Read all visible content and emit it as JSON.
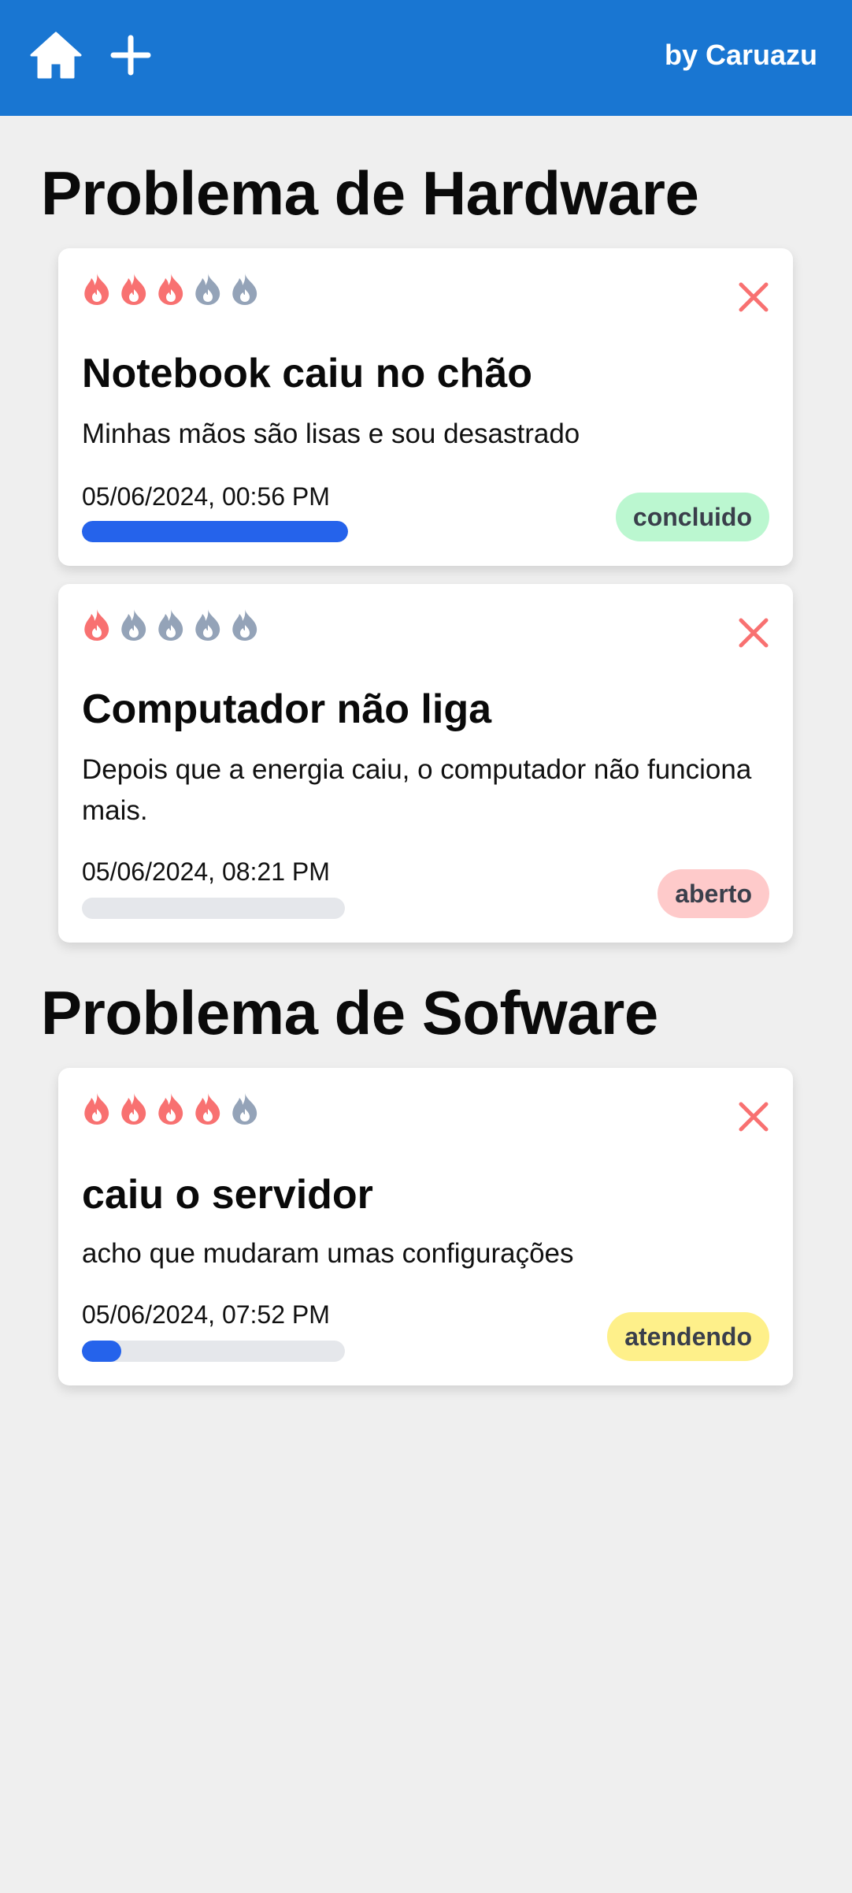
{
  "header": {
    "author": "by Caruazu",
    "home_icon": "home-icon",
    "add_icon": "plus-icon"
  },
  "colors": {
    "header_bg": "#1976d2",
    "flame_active": "#f87171",
    "flame_inactive": "#94a3b8",
    "close": "#f87171",
    "progress_fill": "#2563eb",
    "progress_track": "#e5e7eb",
    "badge_concluido": "#bbf7d0",
    "badge_aberto": "#fecaca",
    "badge_atendendo": "#fef08a"
  },
  "sections": [
    {
      "title": "Problema de Hardware",
      "cards": [
        {
          "priority": 3,
          "max_priority": 5,
          "title": "Notebook caiu no chão",
          "description": "Minhas mãos são lisas e sou desastrado",
          "date": "05/06/2024, 00:56 PM",
          "progress": 1.0,
          "status": "concluido"
        },
        {
          "priority": 1,
          "max_priority": 5,
          "title": "Computador não liga",
          "description": "Depois que a energia caiu, o computador não funciona mais.",
          "date": "05/06/2024, 08:21 PM",
          "progress": 0.0,
          "status": "aberto"
        }
      ]
    },
    {
      "title": "Problema de Sofware",
      "cards": [
        {
          "priority": 4,
          "max_priority": 5,
          "title": "caiu o servidor",
          "description": "acho que mudaram umas configurações",
          "date": "05/06/2024, 07:52 PM",
          "progress": 0.15,
          "status": "atendendo"
        }
      ]
    }
  ]
}
